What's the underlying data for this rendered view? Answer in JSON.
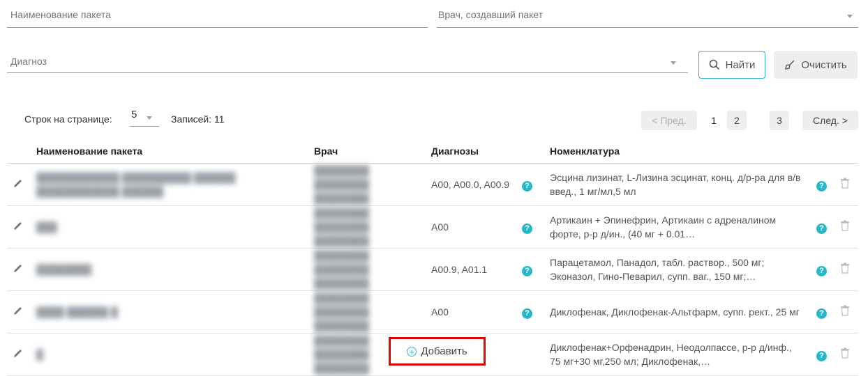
{
  "filters": {
    "package_name_placeholder": "Наименование пакета",
    "doctor_placeholder": "Врач, создавший пакет",
    "diagnosis_placeholder": "Диагноз",
    "find_label": "Найти",
    "clear_label": "Очистить"
  },
  "pagination": {
    "rows_per_page_label": "Строк на странице:",
    "rows_per_page_value": "5",
    "records_label": "Записей:",
    "records_count": "11",
    "prev_label": "< Пред.",
    "pages": [
      "1",
      "2",
      "3"
    ],
    "next_label": "След. >"
  },
  "table": {
    "headers": {
      "name": "Наименование пакета",
      "doctor": "Врач",
      "diagnoses": "Диагнозы",
      "nomenclature": "Номенклатура"
    },
    "rows": [
      {
        "name": "████████████ ██████████ ██████ ████████████ ██████",
        "doctor": "████████ ████████ ████████",
        "diagnoses": "A00, A00.0, A00.9",
        "nomenclature": "Эсцина лизинат, L-Лизина эсцинат, конц. д/р-ра для в/в введ., 1 мг/мл,5 мл"
      },
      {
        "name": "███",
        "doctor": "████████ ████████ ████████",
        "diagnoses": "A00",
        "nomenclature": "Артикаин + Эпинефрин, Артикаин с адреналином форте, р-р д/ин., (40 мг + 0.01…"
      },
      {
        "name": "████████",
        "doctor": "████████ ████████ ████████",
        "diagnoses": "A00.9, A01.1",
        "nomenclature": "Парацетамол, Панадол, табл. раствор., 500 мг; Эконазол, Гино-Певарил, супп. ваг., 150 мг;…"
      },
      {
        "name": "████ ██████ █",
        "doctor": "████████ ████████ ████████",
        "diagnoses": "A00",
        "nomenclature": "Диклофенак, Диклофенак-Альтфарм, супп. рект., 25 мг"
      },
      {
        "name": "█",
        "doctor": "████████ ████████ ████████",
        "diagnoses": "",
        "nomenclature": "Диклофенак+Орфенадрин, Неодолпассе, р-р д/инф., 75 мг+30 мг,250 мл; Диклофенак,…"
      }
    ]
  },
  "add_button_label": "Добавить",
  "colors": {
    "accent": "#29b6c8",
    "highlight": "#e00000"
  }
}
